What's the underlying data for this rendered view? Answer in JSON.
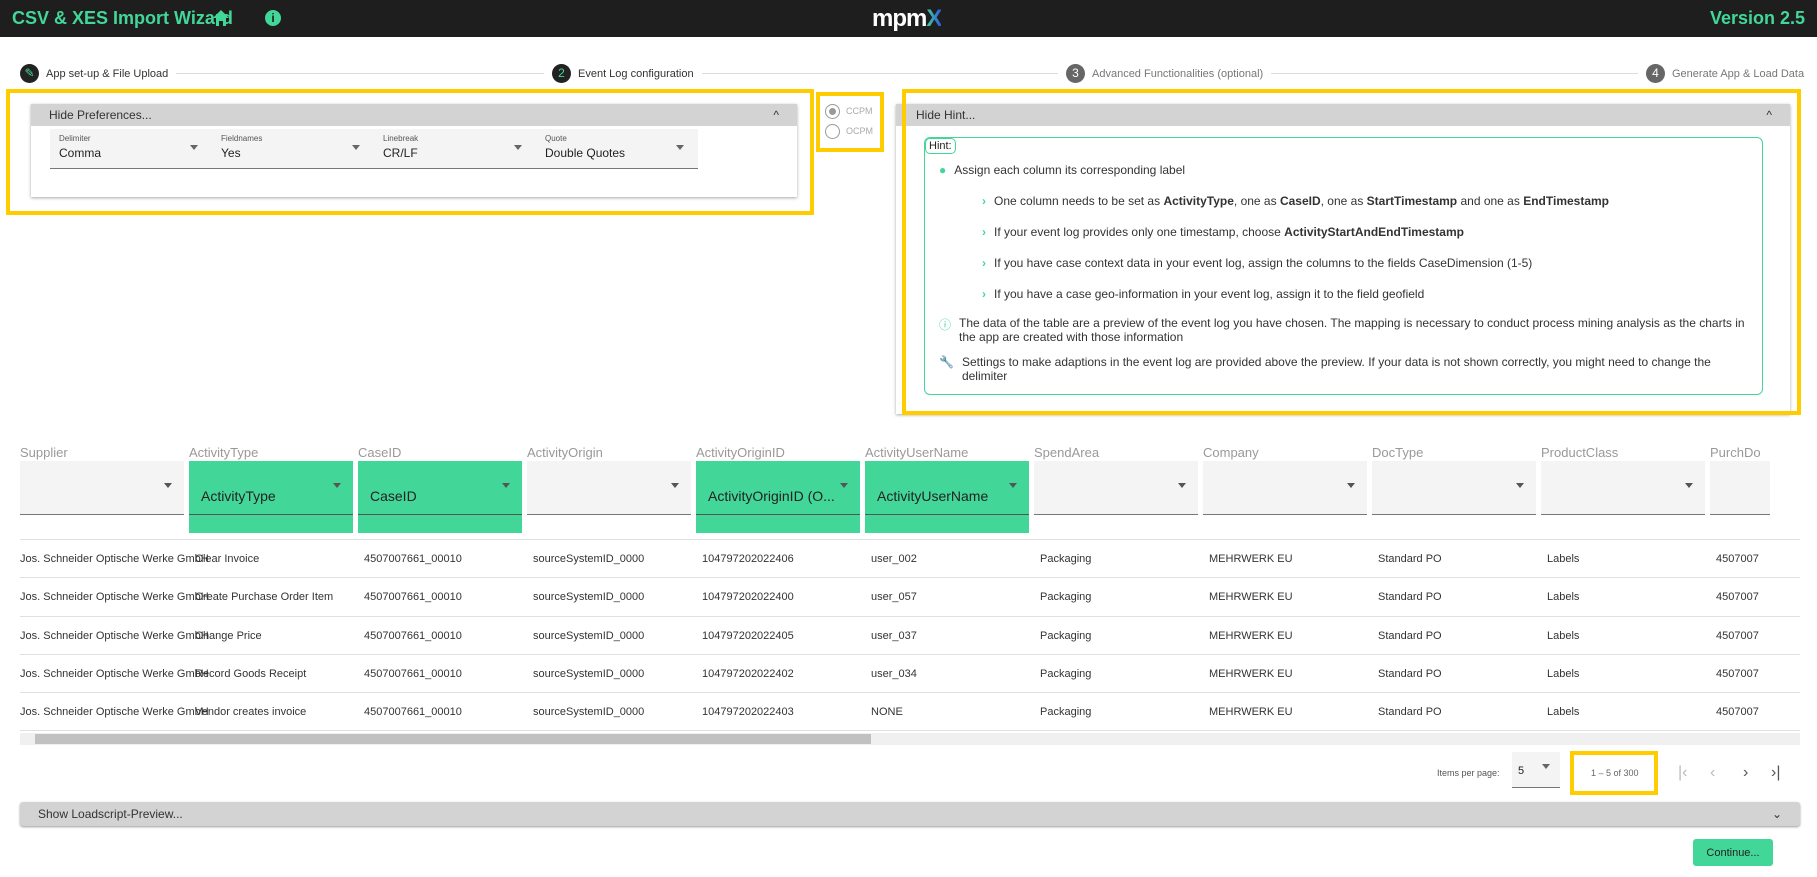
{
  "header": {
    "title": "CSV & XES Import Wizard",
    "logo": "mpmX",
    "version": "Version 2.5",
    "icons": [
      "home-icon",
      "info-icon"
    ]
  },
  "stepper": [
    {
      "num": "",
      "label": "App set-up & File Upload",
      "icon": "pencil-icon"
    },
    {
      "num": "2",
      "label": "Event Log configuration"
    },
    {
      "num": "3",
      "label": "Advanced Functionalities (optional)"
    },
    {
      "num": "4",
      "label": "Generate App & Load Data"
    }
  ],
  "preferences": {
    "toggle_label": "Hide Preferences...",
    "fields": [
      {
        "label": "Delimiter",
        "value": "Comma"
      },
      {
        "label": "Fieldnames",
        "value": "Yes"
      },
      {
        "label": "Linebreak",
        "value": "CR/LF"
      },
      {
        "label": "Quote",
        "value": "Double Quotes"
      }
    ]
  },
  "mode": {
    "options": [
      {
        "label": "CCPM",
        "selected": true
      },
      {
        "label": "OCPM",
        "selected": false
      }
    ]
  },
  "hint": {
    "toggle_label": "Hide Hint...",
    "tag": "Hint:",
    "main": "Assign each column its corresponding label",
    "bullet1": {
      "a": "One column needs to be set as ",
      "b": "ActivityType",
      "c": ", one as ",
      "d": "CaseID",
      "e": ", one as ",
      "f": "StartTimestamp",
      "g": " and one as ",
      "h": "EndTimestamp"
    },
    "bullet2": {
      "a": "If your event log provides only one timestamp, choose ",
      "b": "ActivityStartAndEndTimestamp"
    },
    "bullet3": "If you have case context data in your event log, assign the columns to the fields CaseDimension (1-5)",
    "bullet4": "If you have a case geo-information in your event log, assign it to the field geofield",
    "info": "The data of the table are a preview of the event log you have chosen. The mapping is necessary to conduct process mining analysis as the charts in the app are created with those information",
    "settings": "Settings to make adaptions in the event log are provided above the preview. If your data is not shown correctly, you might need to change the delimiter"
  },
  "table": {
    "columns": [
      {
        "header": "Supplier",
        "mapping": ""
      },
      {
        "header": "ActivityType",
        "mapping": "ActivityType"
      },
      {
        "header": "CaseID",
        "mapping": "CaseID"
      },
      {
        "header": "ActivityOrigin",
        "mapping": ""
      },
      {
        "header": "ActivityOriginID",
        "mapping": "ActivityOriginID (O..."
      },
      {
        "header": "ActivityUserName",
        "mapping": "ActivityUserName"
      },
      {
        "header": "SpendArea",
        "mapping": ""
      },
      {
        "header": "Company",
        "mapping": ""
      },
      {
        "header": "DocType",
        "mapping": ""
      },
      {
        "header": "ProductClass",
        "mapping": ""
      },
      {
        "header": "PurchDo",
        "mapping": ""
      }
    ],
    "rows": [
      [
        "Jos. Schneider Optische Werke GmbH",
        "Clear Invoice",
        "4507007661_00010",
        "sourceSystemID_0000",
        "104797202022406",
        "user_002",
        "Packaging",
        "MEHRWERK EU",
        "Standard PO",
        "Labels",
        "4507007"
      ],
      [
        "Jos. Schneider Optische Werke GmbH",
        "Create Purchase Order Item",
        "4507007661_00010",
        "sourceSystemID_0000",
        "104797202022400",
        "user_057",
        "Packaging",
        "MEHRWERK EU",
        "Standard PO",
        "Labels",
        "4507007"
      ],
      [
        "Jos. Schneider Optische Werke GmbH",
        "Change Price",
        "4507007661_00010",
        "sourceSystemID_0000",
        "104797202022405",
        "user_037",
        "Packaging",
        "MEHRWERK EU",
        "Standard PO",
        "Labels",
        "4507007"
      ],
      [
        "Jos. Schneider Optische Werke GmbH",
        "Record Goods Receipt",
        "4507007661_00010",
        "sourceSystemID_0000",
        "104797202022402",
        "user_034",
        "Packaging",
        "MEHRWERK EU",
        "Standard PO",
        "Labels",
        "4507007"
      ],
      [
        "Jos. Schneider Optische Werke GmbH",
        "Vendor creates invoice",
        "4507007661_00010",
        "sourceSystemID_0000",
        "104797202022403",
        "NONE",
        "Packaging",
        "MEHRWERK EU",
        "Standard PO",
        "Labels",
        "4507007"
      ]
    ]
  },
  "pagination": {
    "items_label": "Items per page:",
    "items_value": "5",
    "range": "1 – 5 of 300"
  },
  "loadscript": {
    "toggle_label": "Show Loadscript-Preview..."
  },
  "continue_label": "Continue...",
  "colors": {
    "accent": "#42d799",
    "highlight": "#ffcc00",
    "topbar": "#1e1e1e"
  }
}
